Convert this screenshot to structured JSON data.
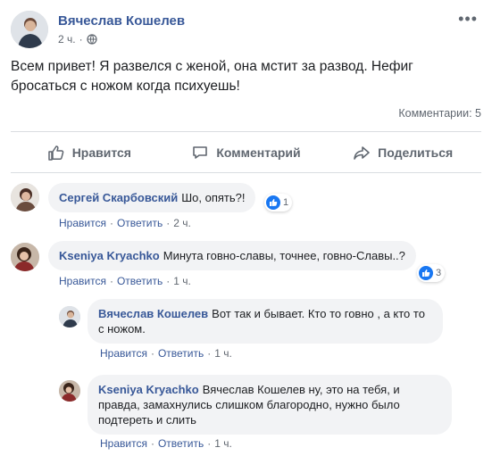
{
  "post": {
    "author": "Вячеслав Кошелев",
    "time": "2 ч.",
    "privacy_icon": "globe-icon",
    "more_icon": "more-icon",
    "more_text": "•••",
    "text": "Всем привет! Я развелся с женой, она мстит за развод. Нефиг бросаться с ножом когда психуешь!",
    "comments_count": "Комментарии: 5",
    "actions": {
      "like": "Нравится",
      "comment": "Комментарий",
      "share": "Поделиться"
    }
  },
  "comments": [
    {
      "author": "Сергей Скарбовский",
      "text": "Шо, опять?!",
      "reactions": "1",
      "like": "Нравится",
      "reply": "Ответить",
      "time": "2 ч."
    },
    {
      "author": "Kseniya Kryachko",
      "text": "Минута говно-славы, точнее, говно-Славы..?",
      "reactions": "3",
      "like": "Нравится",
      "reply": "Ответить",
      "time": "1 ч."
    }
  ],
  "replies": [
    {
      "author": "Вячеслав Кошелев",
      "text": "Вот так и бывает. Кто то говно , а кто то с ножом.",
      "like": "Нравится",
      "reply": "Ответить",
      "time": "1 ч."
    },
    {
      "author": "Kseniya Kryachko",
      "text": "Вячеслав Кошелев ну, это на тебя, и правда, замахнулись слишком благородно, нужно было подтереть и слить",
      "like": "Нравится",
      "reply": "Ответить",
      "time": "1 ч."
    }
  ],
  "separator": "·",
  "colors": {
    "link": "#385898",
    "meta": "#606770",
    "bubble": "#f2f3f5",
    "like_blue": "#1877f2"
  }
}
